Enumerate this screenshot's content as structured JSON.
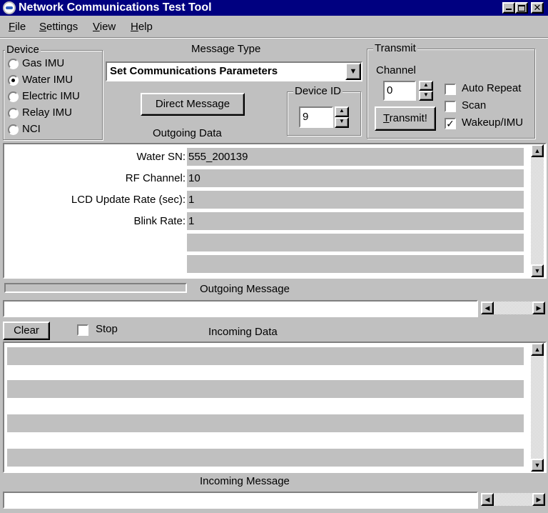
{
  "window": {
    "title": "Network Communications Test Tool",
    "minimize_icon": "minimize-icon",
    "maximize_icon": "maximize-icon",
    "close_icon": "close-icon"
  },
  "menu": {
    "items": [
      "File",
      "Settings",
      "View",
      "Help"
    ]
  },
  "device": {
    "legend": "Device",
    "options": [
      "Gas IMU",
      "Water IMU",
      "Electric IMU",
      "Relay IMU",
      "NCI"
    ],
    "selected": "Water IMU"
  },
  "message_type": {
    "label": "Message Type",
    "selected": "Set Communications Parameters"
  },
  "direct_message_label": "Direct Message",
  "device_id": {
    "legend": "Device ID",
    "value": "9"
  },
  "outgoing_data_label": "Outgoing Data",
  "transmit": {
    "legend": "Transmit",
    "channel_label": "Channel",
    "channel_value": "0",
    "button_label": "Transmit!",
    "auto_repeat_label": "Auto Repeat",
    "auto_repeat_checked": false,
    "scan_label": "Scan",
    "scan_checked": false,
    "wakeup_label": "Wakeup/IMU",
    "wakeup_checked": true
  },
  "outgoing_fields": [
    {
      "label": "Water SN:",
      "value": "555_200139"
    },
    {
      "label": "RF Channel:",
      "value": "10"
    },
    {
      "label": "LCD Update Rate (sec):",
      "value": "1"
    },
    {
      "label": "Blink Rate:",
      "value": "1"
    },
    {
      "label": "",
      "value": ""
    },
    {
      "label": "",
      "value": ""
    }
  ],
  "outgoing_message_label": "Outgoing Message",
  "outgoing_message_value": "",
  "clear_label": "Clear",
  "stop_label": "Stop",
  "stop_checked": false,
  "incoming_data_label": "Incoming Data",
  "incoming_message_label": "Incoming Message",
  "incoming_message_value": "",
  "colors": {
    "titlebar": "#000080",
    "face": "#c0c0c0",
    "window": "#ffffff"
  }
}
